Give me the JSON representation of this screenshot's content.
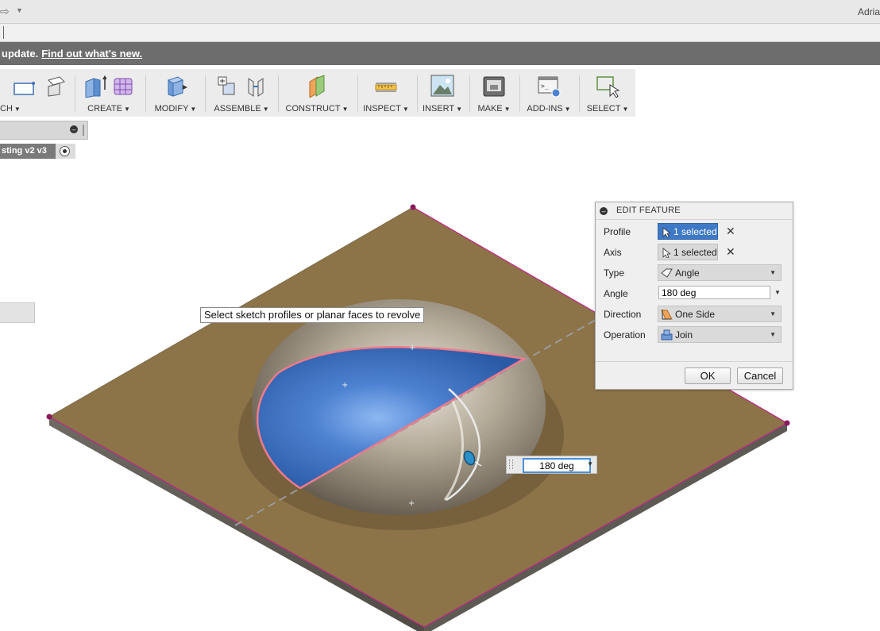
{
  "titlebar": {
    "user": "Adria"
  },
  "banner": {
    "text": "update.",
    "link": "Find out what's new."
  },
  "ribbon": {
    "groups": [
      {
        "label": "CH",
        "icon": "sketch-icon"
      },
      {
        "label": "CREATE",
        "icon": "extrude-icon"
      },
      {
        "label": "MODIFY",
        "icon": "press-pull-icon"
      },
      {
        "label": "ASSEMBLE",
        "icon": "joint-icon"
      },
      {
        "label": "CONSTRUCT",
        "icon": "plane-icon"
      },
      {
        "label": "INSPECT",
        "icon": "measure-icon"
      },
      {
        "label": "INSERT",
        "icon": "image-icon"
      },
      {
        "label": "MAKE",
        "icon": "printer-icon"
      },
      {
        "label": "ADD-INS",
        "icon": "scripts-icon"
      },
      {
        "label": "SELECT",
        "icon": "select-window-icon"
      }
    ]
  },
  "browser": {
    "document_name": "sting v2 v3"
  },
  "viewport": {
    "tooltip": "Select sketch profiles or planar faces to revolve",
    "dimension_value": "180 deg"
  },
  "dialog": {
    "title": "EDIT FEATURE",
    "profile": {
      "label": "Profile",
      "value": "1 selected"
    },
    "axis": {
      "label": "Axis",
      "value": "1 selected"
    },
    "type": {
      "label": "Type",
      "value": "Angle"
    },
    "angle": {
      "label": "Angle",
      "value": "180 deg"
    },
    "direction": {
      "label": "Direction",
      "value": "One Side"
    },
    "operation": {
      "label": "Operation",
      "value": "Join"
    },
    "ok": "OK",
    "cancel": "Cancel"
  },
  "colors": {
    "ground_plane": "#8c7348",
    "profile_fill": "#3a6fc0",
    "selection_active": "#3e79c7",
    "sketch_line": "#c2258a"
  }
}
